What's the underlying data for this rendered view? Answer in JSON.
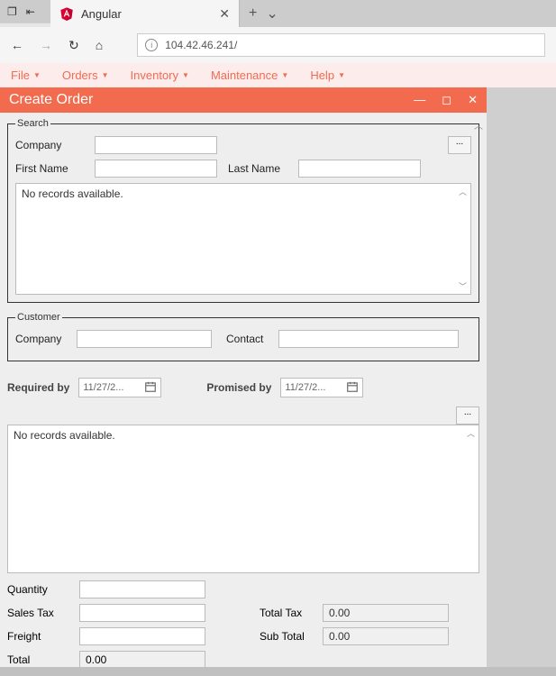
{
  "browser": {
    "tab_title": "Angular",
    "url": "104.42.46.241/"
  },
  "menu": {
    "file": "File",
    "orders": "Orders",
    "inventory": "Inventory",
    "maintenance": "Maintenance",
    "help": "Help"
  },
  "window": {
    "title": "Create Order"
  },
  "search": {
    "legend": "Search",
    "company_label": "Company",
    "company_value": "",
    "first_name_label": "First Name",
    "first_name_value": "",
    "last_name_label": "Last Name",
    "last_name_value": "",
    "grid_empty": "No records available.",
    "dots": "..."
  },
  "customer": {
    "legend": "Customer",
    "company_label": "Company",
    "company_value": "",
    "contact_label": "Contact",
    "contact_value": ""
  },
  "dates": {
    "required_label": "Required by",
    "required_value": "11/27/2...",
    "promised_label": "Promised by",
    "promised_value": "11/27/2..."
  },
  "order_grid": {
    "empty": "No records available.",
    "dots": "..."
  },
  "totals": {
    "quantity_label": "Quantity",
    "quantity_value": "",
    "sales_tax_label": "Sales Tax",
    "sales_tax_value": "",
    "freight_label": "Freight",
    "freight_value": "",
    "total_label": "Total",
    "total_value": "0.00",
    "total_tax_label": "Total Tax",
    "total_tax_value": "0.00",
    "sub_total_label": "Sub Total",
    "sub_total_value": "0.00"
  }
}
